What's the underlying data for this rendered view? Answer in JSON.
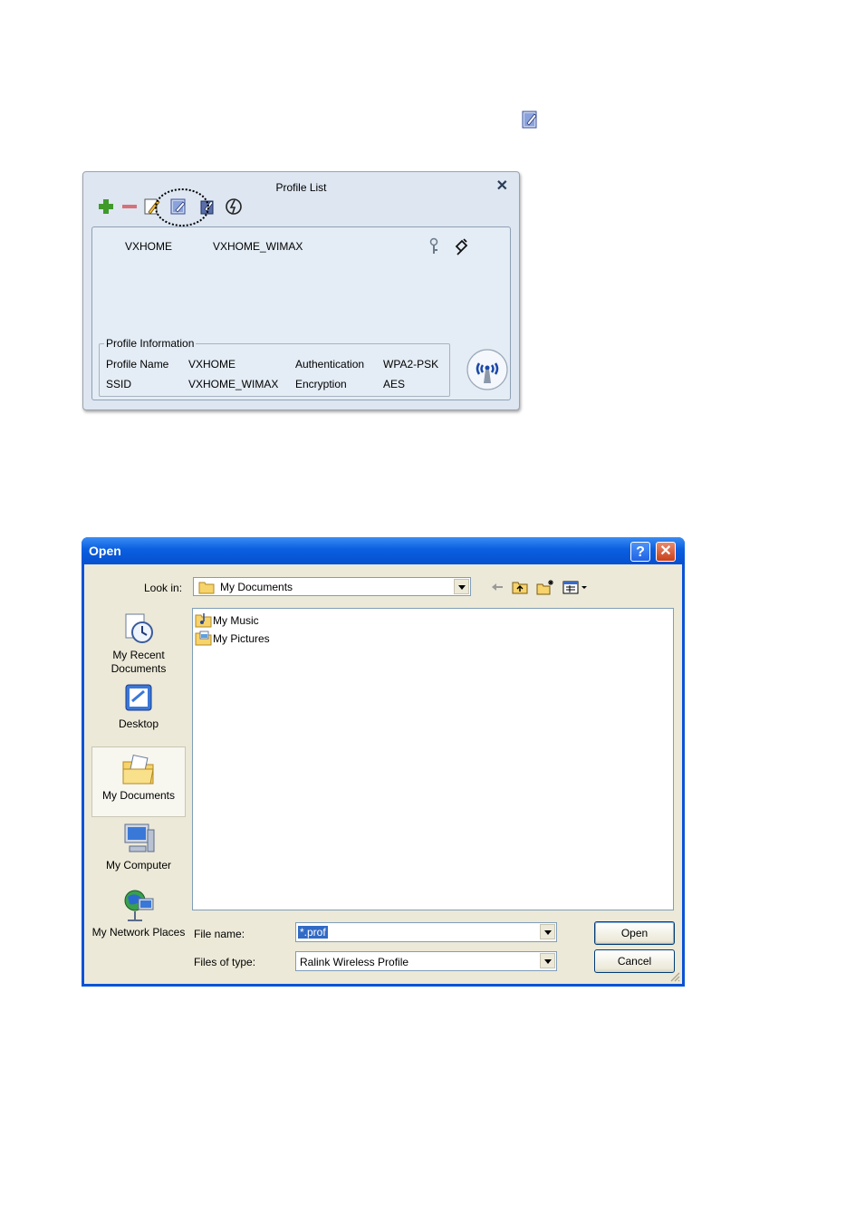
{
  "profile_list": {
    "title": "Profile List",
    "close_symbol": "✕",
    "toolbar": [
      "add-icon",
      "remove-icon",
      "edit-icon",
      "import-icon",
      "export-icon",
      "scan-icon"
    ],
    "rows": [
      {
        "profile": "VXHOME",
        "ssid": "VXHOME_WIMAX"
      }
    ],
    "info": {
      "legend": "Profile Information",
      "profile_name_label": "Profile Name",
      "profile_name": "VXHOME",
      "ssid_label": "SSID",
      "ssid": "VXHOME_WIMAX",
      "auth_label": "Authentication",
      "auth": "WPA2-PSK",
      "enc_label": "Encryption",
      "enc": "AES"
    }
  },
  "open_dialog": {
    "title": "Open",
    "help_symbol": "?",
    "close_symbol": "✕",
    "look_in_label": "Look in:",
    "look_in_value": "My Documents",
    "places": [
      {
        "label": "My Recent Documents",
        "icon": "recent-documents-icon"
      },
      {
        "label": "Desktop",
        "icon": "desktop-icon"
      },
      {
        "label": "My Documents",
        "icon": "my-documents-icon",
        "selected": true
      },
      {
        "label": "My Computer",
        "icon": "my-computer-icon"
      },
      {
        "label": "My Network Places",
        "icon": "network-places-icon"
      }
    ],
    "files": [
      {
        "name": "My Music",
        "icon": "music-folder-icon"
      },
      {
        "name": "My Pictures",
        "icon": "pictures-folder-icon"
      }
    ],
    "file_name_label": "File name:",
    "file_name_value": "*.prof",
    "files_of_type_label": "Files of type:",
    "files_of_type_value": "Ralink Wireless Profile",
    "open_button": "Open",
    "cancel_button": "Cancel"
  }
}
